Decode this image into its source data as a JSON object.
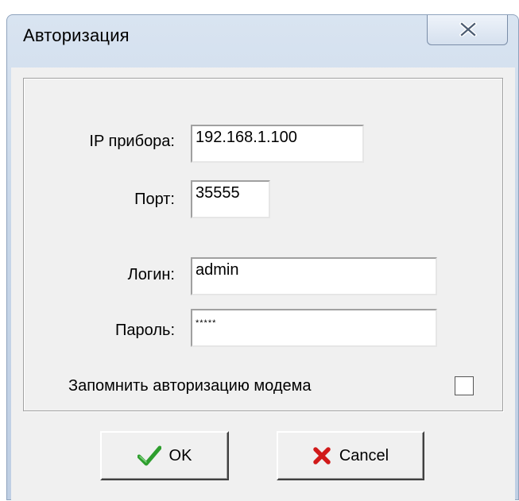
{
  "window": {
    "title": "Авторизация"
  },
  "form": {
    "ip_label": "IP прибора:",
    "ip_value": "192.168.1.100",
    "port_label": "Порт:",
    "port_value": "35555",
    "login_label": "Логин:",
    "login_value": "admin",
    "password_label": "Пароль:",
    "password_value": "*****",
    "remember_label": "Запомнить авторизацию модема",
    "remember_checked": false
  },
  "buttons": {
    "ok_label": "OK",
    "cancel_label": "Cancel"
  },
  "icons": {
    "close": "close-icon",
    "ok": "checkmark-icon",
    "cancel": "cross-icon"
  },
  "colors": {
    "checkmark": "#2e9e2e",
    "cross": "#d11a1a"
  }
}
